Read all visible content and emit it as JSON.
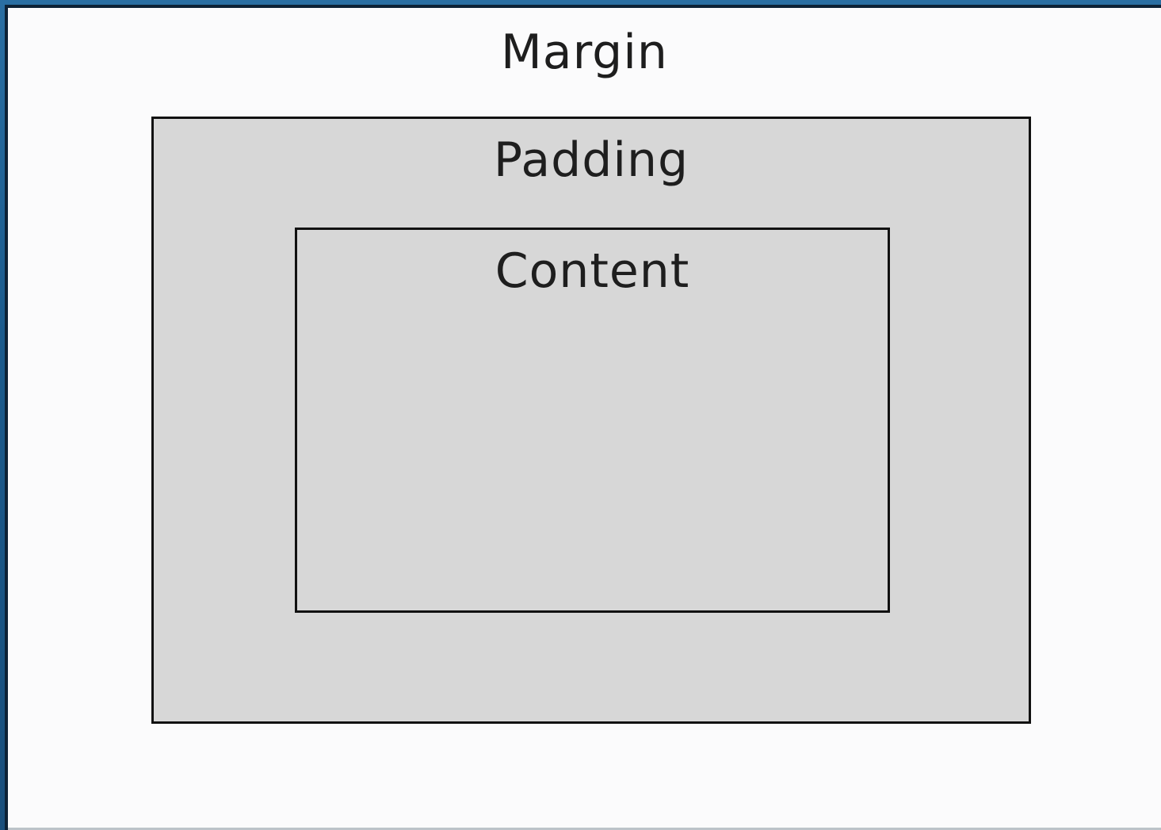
{
  "diagram": {
    "margin_label": "Margin",
    "padding_label": "Padding",
    "content_label": "Content"
  }
}
